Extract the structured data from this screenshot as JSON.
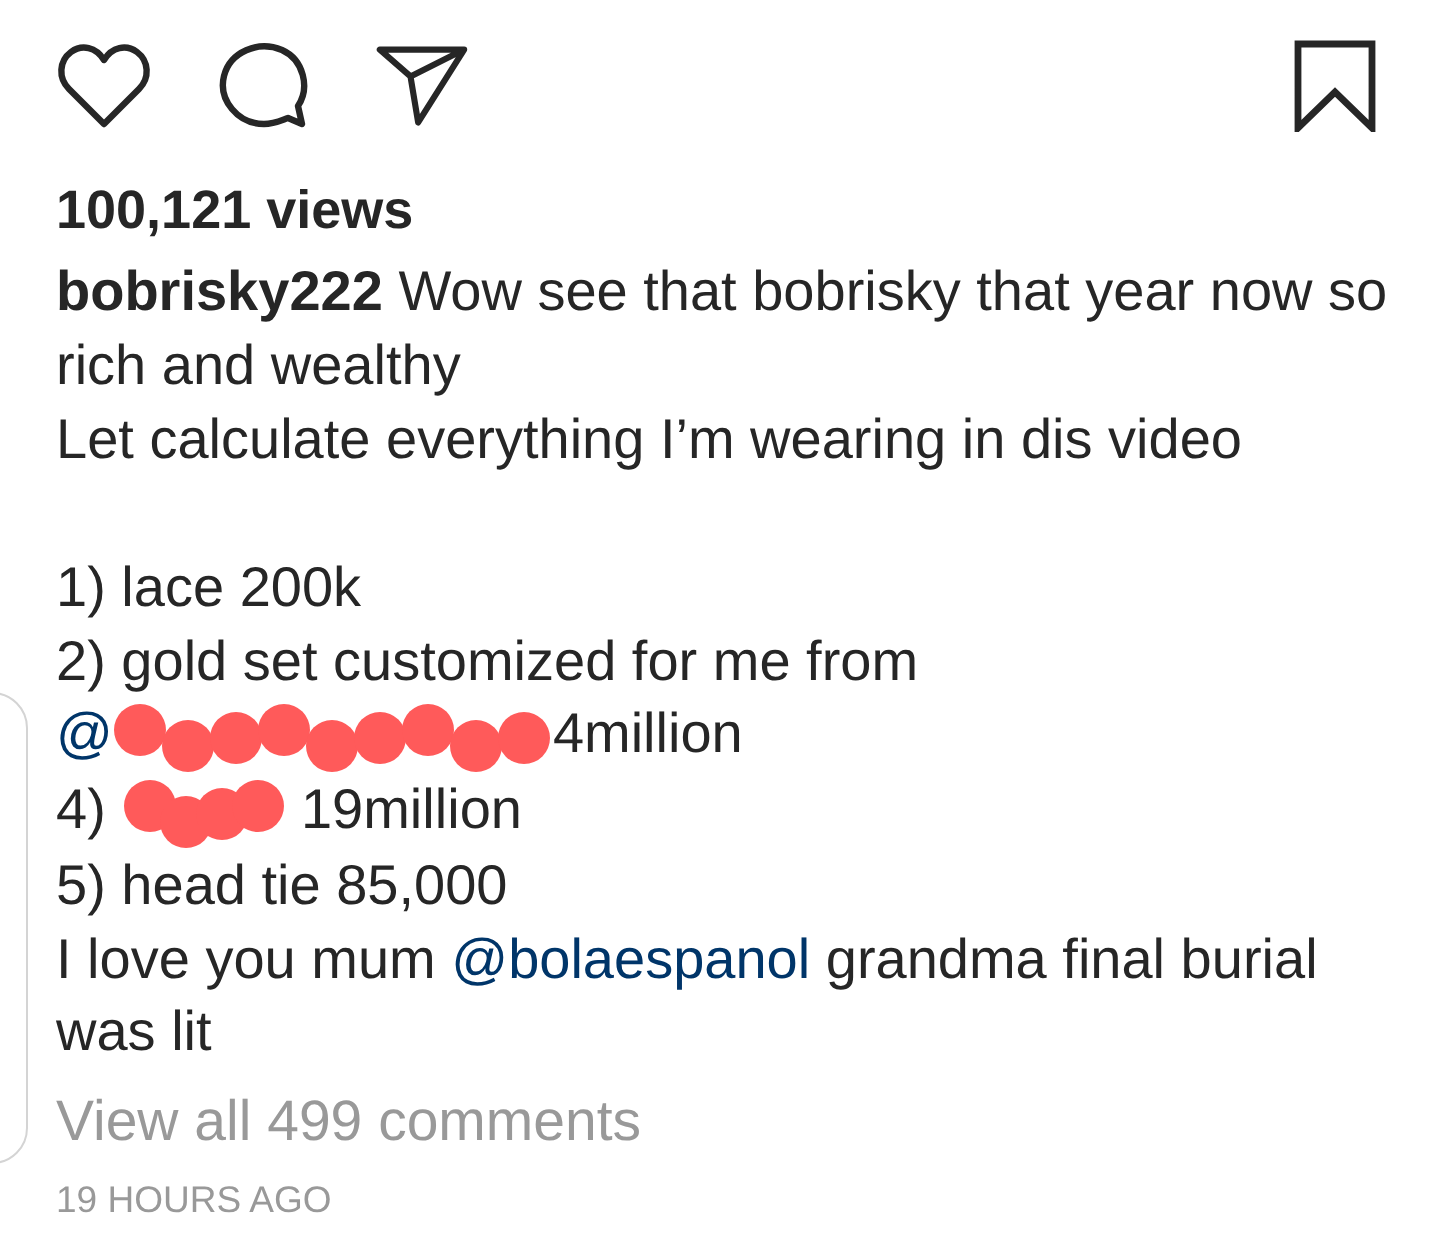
{
  "actions": {
    "buttons": [
      {
        "kind": "like"
      },
      {
        "kind": "comment"
      },
      {
        "kind": "share"
      }
    ],
    "save": {
      "kind": "save"
    }
  },
  "views": "100,121 views",
  "caption": {
    "username": "bobrisky222",
    "intro": [
      [
        {
          "kind": "text",
          "text": "Wow see that bobrisky that year now so rich and wealthy"
        }
      ],
      [
        {
          "kind": "text",
          "text": "Let calculate everything I’m wearing in dis video"
        }
      ]
    ],
    "items": [
      [
        {
          "kind": "text",
          "text": "1) lace 200k"
        }
      ],
      [
        {
          "kind": "text",
          "text": "2) gold set customized for me from"
        }
      ],
      [
        {
          "kind": "mention",
          "text": "@"
        },
        {
          "kind": "redacted"
        },
        {
          "kind": "text",
          "text": "4million"
        }
      ],
      [
        {
          "kind": "text",
          "text": "4) "
        },
        {
          "kind": "redacted"
        },
        {
          "kind": "text",
          "text": " 19million"
        }
      ],
      [
        {
          "kind": "text",
          "text": "5) head tie 85,000"
        }
      ]
    ],
    "closing": [
      [
        {
          "kind": "text",
          "text": "I love you mum "
        },
        {
          "kind": "mention",
          "text": "@bolaespanol"
        },
        {
          "kind": "text",
          "text": " grandma final burial was lit"
        }
      ]
    ]
  },
  "comments_link": "View all 499 comments",
  "timestamp": "19 HOURS AGO"
}
